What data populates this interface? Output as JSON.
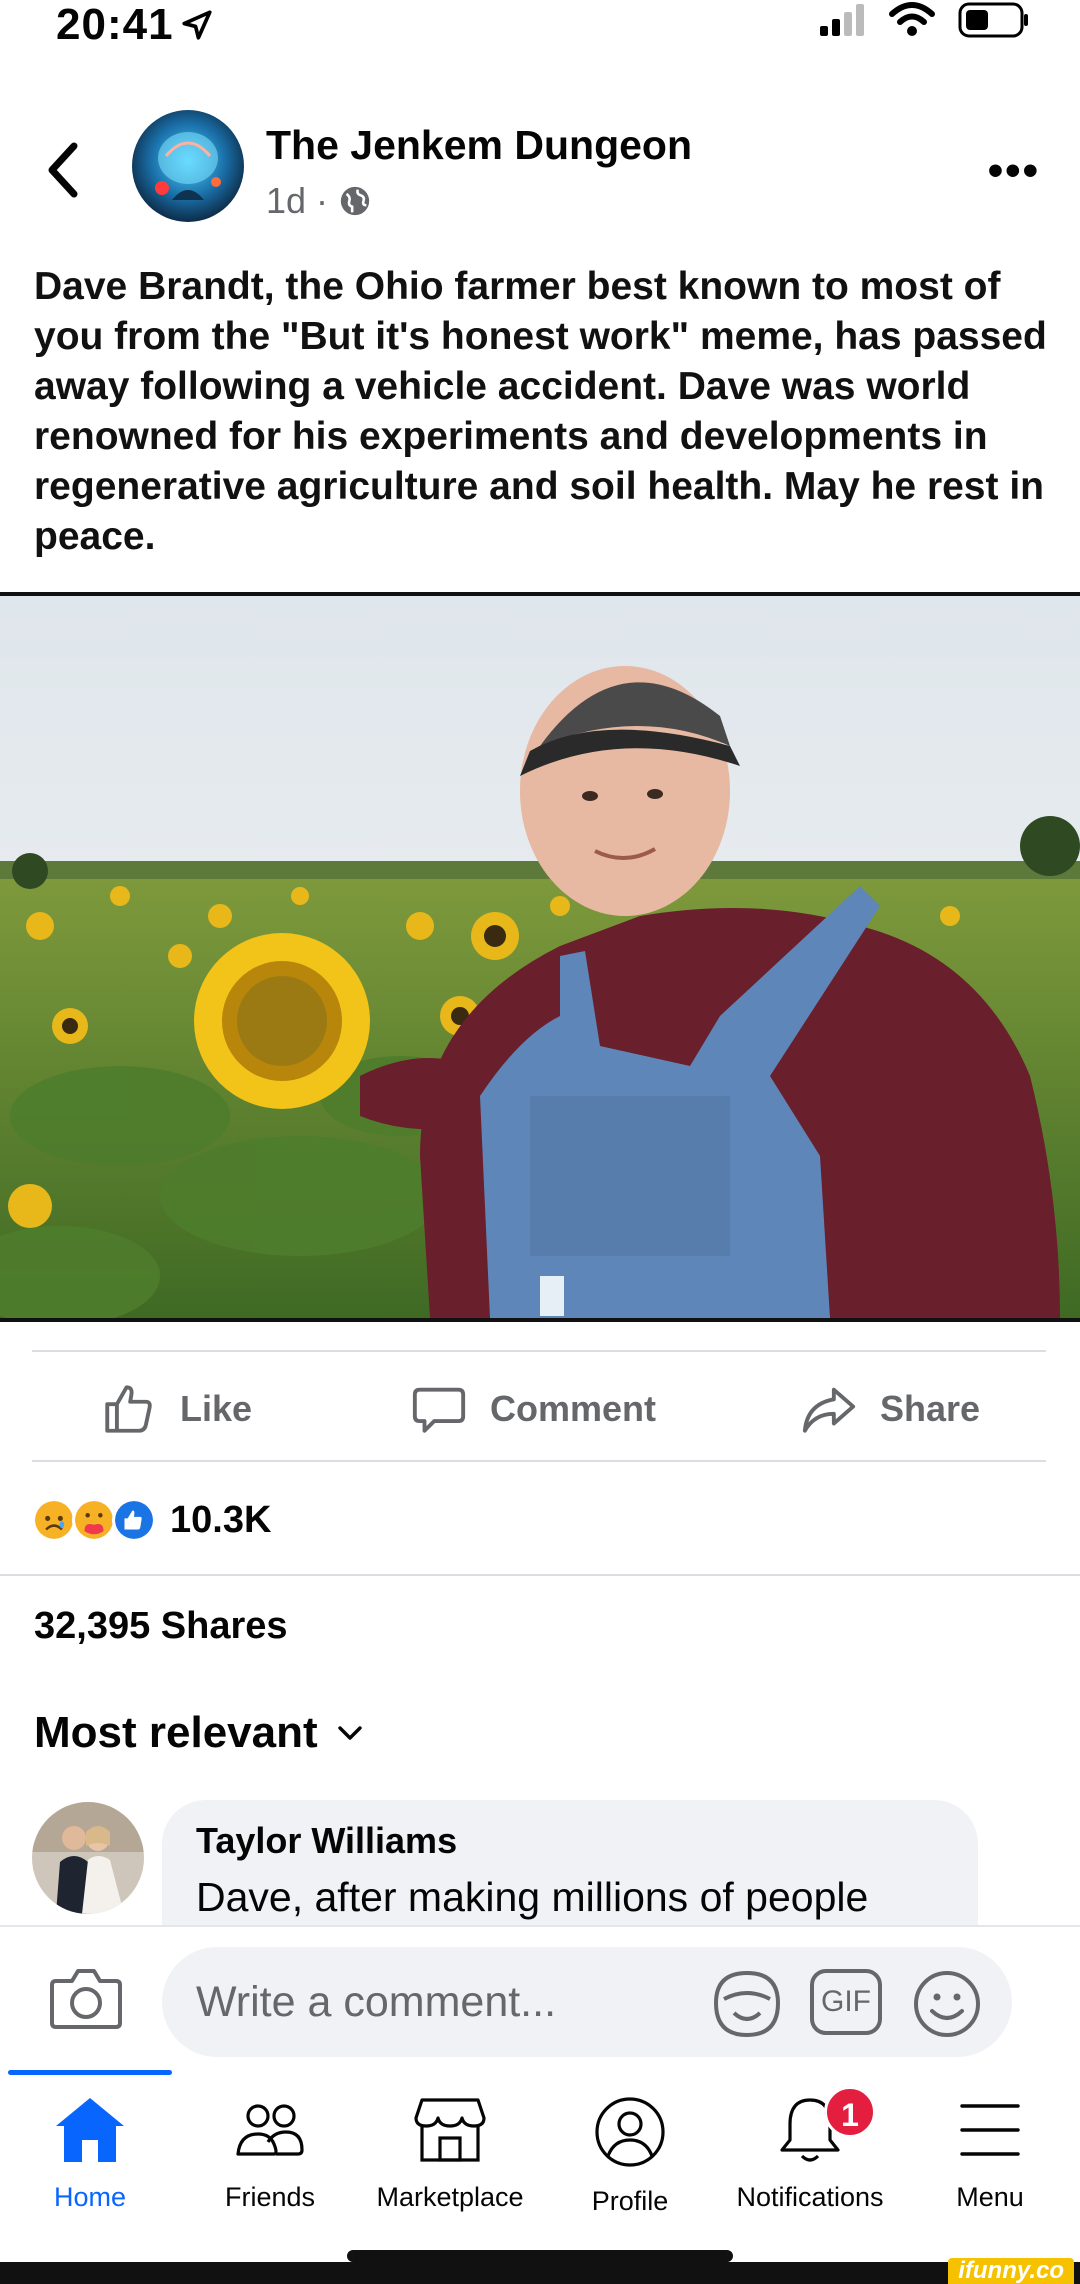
{
  "status_bar": {
    "time": "20:41",
    "icons": [
      "location-arrow-icon",
      "signal-icon",
      "wifi-icon",
      "battery-icon"
    ]
  },
  "post": {
    "page_name": "The Jenkem Dungeon",
    "time_ago": "1d",
    "separator": "·",
    "privacy_icon": "globe-icon",
    "more_label": "•••",
    "text": "Dave Brandt, the Ohio farmer best known to most of you from the \"But it's honest work\" meme, has passed away following a vehicle accident. Dave was world renowned for his experiments and developments in regenerative agriculture and soil health. May he rest in peace."
  },
  "actions": {
    "like": "Like",
    "comment": "Comment",
    "share": "Share"
  },
  "reactions": {
    "icons": [
      "sad-reaction-icon",
      "care-reaction-icon",
      "like-reaction-icon"
    ],
    "count": "10.3K"
  },
  "shares": "32,395 Shares",
  "sort": {
    "label": "Most relevant"
  },
  "comments": [
    {
      "author": "Taylor Williams",
      "text": "Dave, after making millions of people"
    }
  ],
  "composer": {
    "placeholder": "Write a comment...",
    "gif_label": "GIF"
  },
  "tabs": [
    {
      "label": "Home",
      "icon": "home-icon",
      "active": true
    },
    {
      "label": "Friends",
      "icon": "friends-icon"
    },
    {
      "label": "Marketplace",
      "icon": "marketplace-icon"
    },
    {
      "label": "Profile",
      "icon": "profile-icon"
    },
    {
      "label": "Notifications",
      "icon": "bell-icon",
      "badge": "1"
    },
    {
      "label": "Menu",
      "icon": "menu-icon"
    }
  ],
  "watermark": "ifunny.co",
  "colors": {
    "accent": "#0866ff",
    "badge": "#e41e3f",
    "secondary_text": "#65676b",
    "bubble": "#f0f2f5"
  }
}
